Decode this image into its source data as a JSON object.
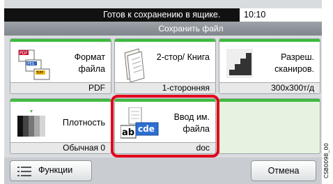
{
  "status": {
    "message": "Готов к сохранению в ящике.",
    "time": "10:10"
  },
  "title": "Сохранить файл",
  "tiles": {
    "format": {
      "label": "Формат файла",
      "value": "PDF"
    },
    "duplex": {
      "label": "2-стор/ Книга",
      "value": "1-сторонняя"
    },
    "resolution": {
      "label": "Разреш. сканиров.",
      "value": "300x300т/д"
    },
    "density": {
      "label": "Плотность",
      "value": "Обычная 0"
    },
    "filename": {
      "label": "Ввод им. файла",
      "value": "doc"
    }
  },
  "buttons": {
    "functions": "Функции",
    "cancel": "Отмена"
  },
  "file_icon_tags": [
    "PDF",
    "JPEG",
    "TIFF"
  ],
  "filename_icon_text": {
    "left": "ab",
    "right": "cde"
  },
  "side_code": "CSB0098_00",
  "colors": {
    "accent": "#3fbb3f",
    "highlight": "#e3001b"
  }
}
